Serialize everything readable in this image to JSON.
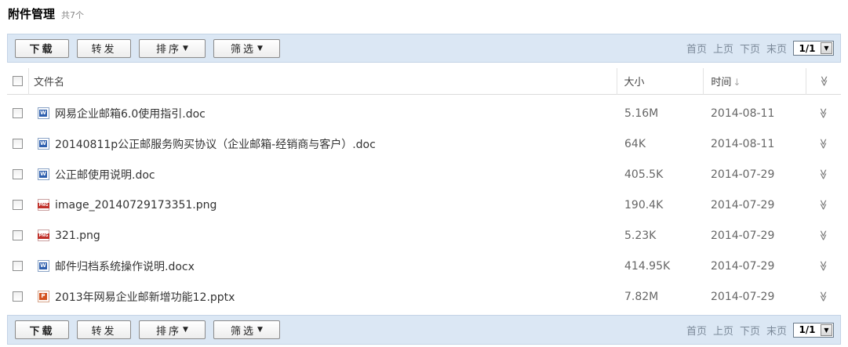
{
  "title": "附件管理",
  "count": "共7个",
  "toolbar": {
    "download": "下载",
    "forward": "转发",
    "sort": "排序",
    "filter": "筛选",
    "caret": "▼"
  },
  "pager": {
    "first": "首页",
    "prev": "上页",
    "next": "下页",
    "last": "末页",
    "page": "1/1"
  },
  "columns": {
    "name": "文件名",
    "size": "大小",
    "time": "时间",
    "time_sort": "↓",
    "expand": "≫"
  },
  "files": [
    {
      "name": "网易企业邮箱6.0使用指引.doc",
      "type": "word",
      "size": "5.16M",
      "time": "2014-08-11"
    },
    {
      "name": "20140811p公正邮服务购买协议（企业邮箱-经销商与客户）.doc",
      "type": "word",
      "size": "64K",
      "time": "2014-08-11"
    },
    {
      "name": "公正邮使用说明.doc",
      "type": "word",
      "size": "405.5K",
      "time": "2014-07-29"
    },
    {
      "name": "image_20140729173351.png",
      "type": "png",
      "size": "190.4K",
      "time": "2014-07-29"
    },
    {
      "name": "321.png",
      "type": "png",
      "size": "5.23K",
      "time": "2014-07-29"
    },
    {
      "name": "邮件归档系统操作说明.docx",
      "type": "word",
      "size": "414.95K",
      "time": "2014-07-29"
    },
    {
      "name": "2013年网易企业邮新增功能12.pptx",
      "type": "ppt",
      "size": "7.82M",
      "time": "2014-07-29"
    }
  ]
}
